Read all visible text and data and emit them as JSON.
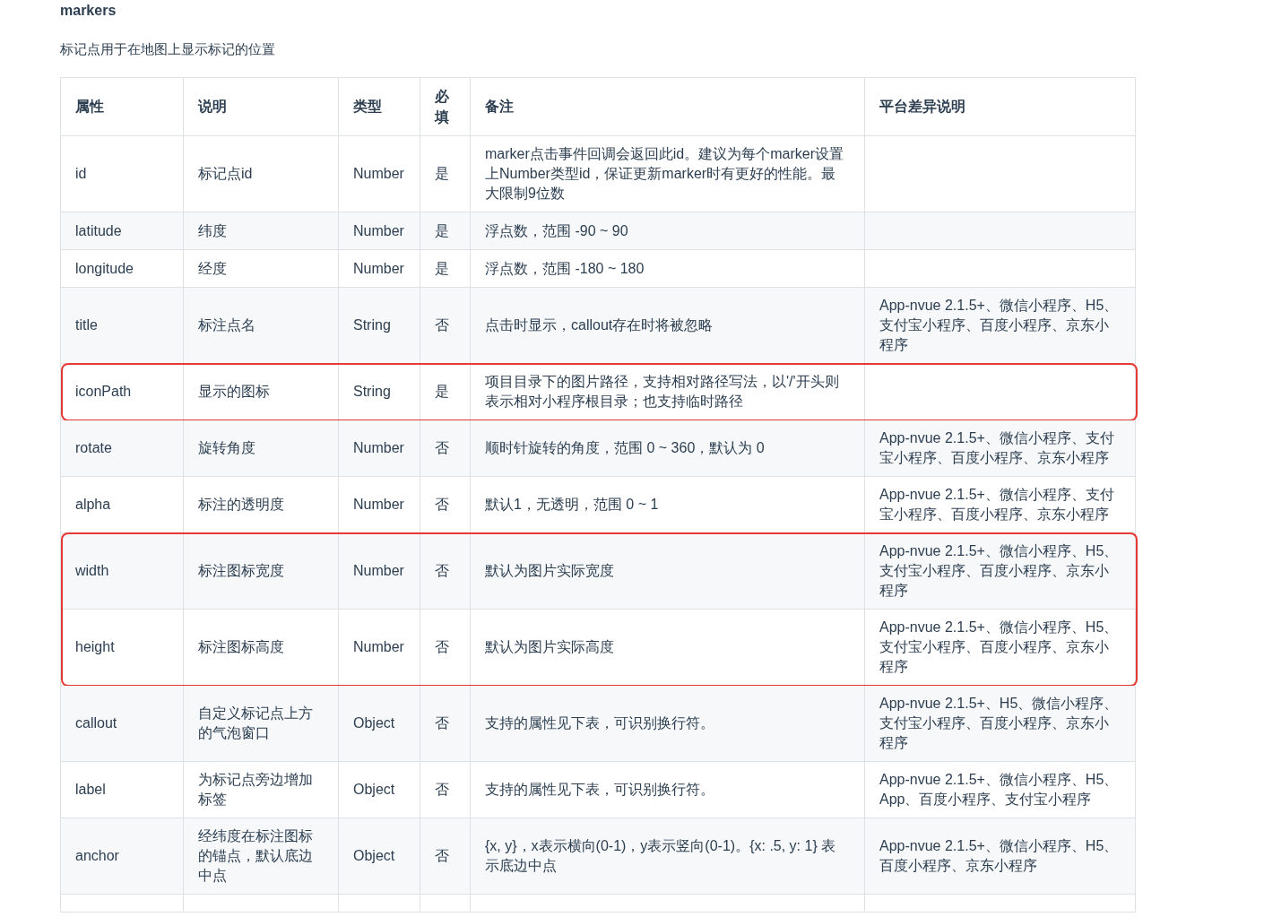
{
  "heading": "markers",
  "description": "标记点用于在地图上显示标记的位置",
  "table": {
    "columns": [
      "属性",
      "说明",
      "类型",
      "必填",
      "备注",
      "平台差异说明"
    ],
    "rows": [
      {
        "cells": [
          "id",
          "标记点id",
          "Number",
          "是",
          "marker点击事件回调会返回此id。建议为每个marker设置上Number类型id，保证更新marker时有更好的性能。最大限制9位数",
          ""
        ],
        "highlighted": false
      },
      {
        "cells": [
          "latitude",
          "纬度",
          "Number",
          "是",
          "浮点数，范围 -90 ~ 90",
          ""
        ],
        "highlighted": false
      },
      {
        "cells": [
          "longitude",
          "经度",
          "Number",
          "是",
          "浮点数，范围 -180 ~ 180",
          ""
        ],
        "highlighted": false
      },
      {
        "cells": [
          "title",
          "标注点名",
          "String",
          "否",
          "点击时显示，callout存在时将被忽略",
          "App-nvue 2.1.5+、微信小程序、H5、支付宝小程序、百度小程序、京东小程序"
        ],
        "highlighted": false
      },
      {
        "cells": [
          "iconPath",
          "显示的图标",
          "String",
          "是",
          "项目目录下的图片路径，支持相对路径写法，以'/'开头则表示相对小程序根目录；也支持临时路径",
          ""
        ],
        "highlighted": true
      },
      {
        "cells": [
          "rotate",
          "旋转角度",
          "Number",
          "否",
          "顺时针旋转的角度，范围 0 ~ 360，默认为 0",
          "App-nvue 2.1.5+、微信小程序、支付宝小程序、百度小程序、京东小程序"
        ],
        "highlighted": false
      },
      {
        "cells": [
          "alpha",
          "标注的透明度",
          "Number",
          "否",
          "默认1，无透明，范围 0 ~ 1",
          "App-nvue 2.1.5+、微信小程序、支付宝小程序、百度小程序、京东小程序"
        ],
        "highlighted": false
      },
      {
        "cells": [
          "width",
          "标注图标宽度",
          "Number",
          "否",
          "默认为图片实际宽度",
          "App-nvue 2.1.5+、微信小程序、H5、支付宝小程序、百度小程序、京东小程序"
        ],
        "highlighted": true
      },
      {
        "cells": [
          "height",
          "标注图标高度",
          "Number",
          "否",
          "默认为图片实际高度",
          "App-nvue 2.1.5+、微信小程序、H5、支付宝小程序、百度小程序、京东小程序"
        ],
        "highlighted": true
      },
      {
        "cells": [
          "callout",
          "自定义标记点上方的气泡窗口",
          "Object",
          "否",
          "支持的属性见下表，可识别换行符。",
          "App-nvue 2.1.5+、H5、微信小程序、支付宝小程序、百度小程序、京东小程序"
        ],
        "highlighted": false
      },
      {
        "cells": [
          "label",
          "为标记点旁边增加标签",
          "Object",
          "否",
          "支持的属性见下表，可识别换行符。",
          "App-nvue 2.1.5+、微信小程序、H5、App、百度小程序、支付宝小程序"
        ],
        "highlighted": false
      },
      {
        "cells": [
          "anchor",
          "经纬度在标注图标的锚点，默认底边中点",
          "Object",
          "否",
          "{x, y}，x表示横向(0-1)，y表示竖向(0-1)。{x: .5, y: 1} 表示底边中点",
          "App-nvue 2.1.5+、微信小程序、H5、百度小程序、京东小程序"
        ],
        "highlighted": false
      }
    ]
  }
}
